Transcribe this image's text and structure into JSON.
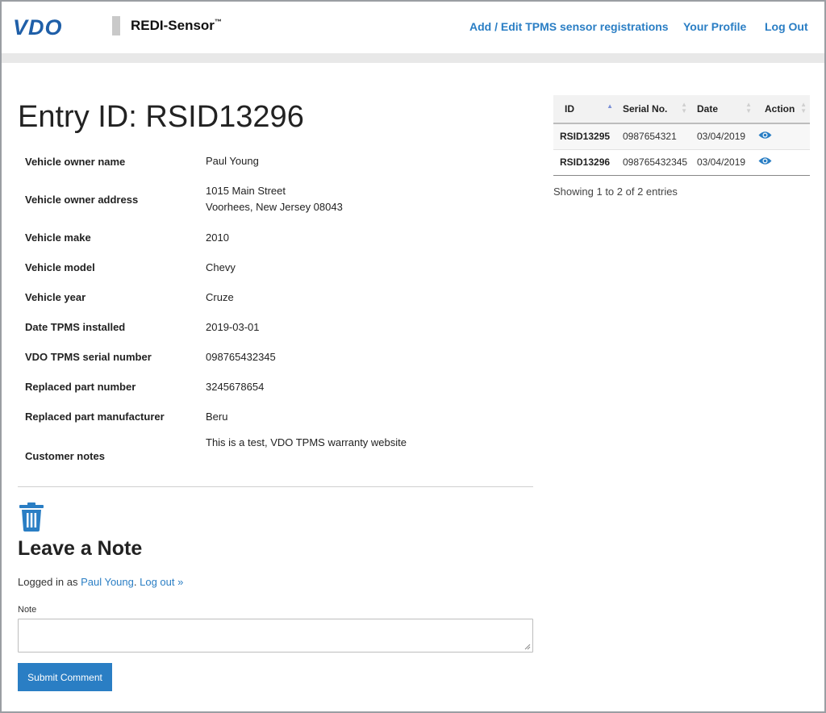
{
  "header": {
    "logo_vdo": "VDO",
    "logo_redi": "REDI-Sensor",
    "logo_tm": "™",
    "nav": {
      "add_edit": "Add / Edit TPMS sensor registrations",
      "profile": "Your Profile",
      "logout": "Log Out"
    }
  },
  "entry": {
    "title": "Entry ID: RSID13296",
    "fields": [
      {
        "label": "Vehicle owner name",
        "value": "Paul Young"
      },
      {
        "label": "Vehicle owner address",
        "value": "1015 Main Street",
        "value2": "Voorhees, New Jersey 08043"
      },
      {
        "label": "Vehicle make",
        "value": "2010"
      },
      {
        "label": "Vehicle model",
        "value": "Chevy"
      },
      {
        "label": "Vehicle year",
        "value": "Cruze"
      },
      {
        "label": "Date TPMS installed",
        "value": "2019-03-01"
      },
      {
        "label": "VDO TPMS serial number",
        "value": "098765432345"
      },
      {
        "label": "Replaced part number",
        "value": "3245678654"
      },
      {
        "label": "Replaced part manufacturer",
        "value": "Beru"
      },
      {
        "label": "Customer notes",
        "value": "This is a test, VDO TPMS warranty website"
      }
    ]
  },
  "note_section": {
    "title": "Leave a Note",
    "logged_prefix": "Logged in as ",
    "user": "Paul Young",
    "period": ".",
    "logout_link": "Log out »",
    "note_label": "Note",
    "note_value": "",
    "submit_label": "Submit Comment"
  },
  "side_table": {
    "columns": [
      "ID",
      "Serial No.",
      "Date",
      "Action"
    ],
    "rows": [
      {
        "id": "RSID13295",
        "serial": "0987654321",
        "date": "03/04/2019",
        "action_icon": "eye-icon"
      },
      {
        "id": "RSID13296",
        "serial": "098765432345",
        "date": "03/04/2019",
        "action_icon": "eye-icon"
      }
    ],
    "showing": "Showing 1 to 2 of 2 entries"
  },
  "colors": {
    "accent": "#2a7ec4",
    "brand_vdo": "#1f5fa8"
  },
  "icons": {
    "trash": "trash-icon",
    "view": "eye-icon"
  }
}
